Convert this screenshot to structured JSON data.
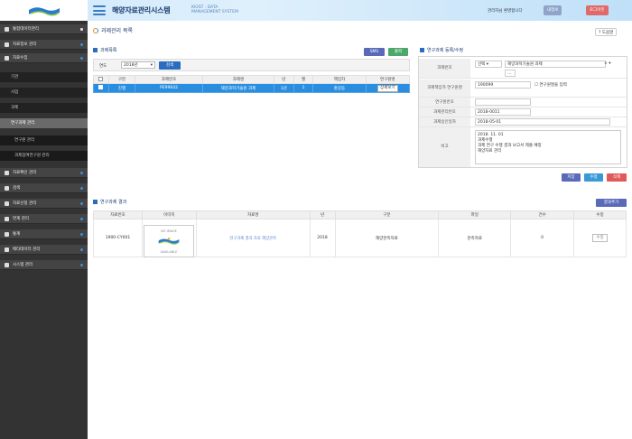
{
  "header": {
    "title": "해양자료관리시스템",
    "subtitle_line1": "KIOST · DATA",
    "subtitle_line2": "MANAGEMENT SYSTEM",
    "user_info": "관리자님 환영합니다",
    "btn_mypage": "내정보",
    "btn_logout": "로그아웃"
  },
  "sidebar": {
    "items": [
      {
        "label": "통합데이터관리"
      },
      {
        "label": "자료정보 관리"
      },
      {
        "label": "자료수집"
      }
    ],
    "subitems": [
      {
        "label": "기관"
      },
      {
        "label": "사업"
      },
      {
        "label": "과제"
      },
      {
        "label": "연구과제 관리"
      },
      {
        "label": "연구원 관리"
      },
      {
        "label": "과제참여연구원 관리"
      }
    ],
    "bottom_items": [
      {
        "label": "자료확인 관리"
      },
      {
        "label": "검색"
      },
      {
        "label": "자료신청 관리"
      },
      {
        "label": "연계 관리"
      },
      {
        "label": "통계"
      },
      {
        "label": "메타데이터 관리"
      },
      {
        "label": "시스템 관리"
      }
    ]
  },
  "page": {
    "title": "과제관리 목록",
    "help_label": "도움말"
  },
  "list_section": {
    "title": "과제목록",
    "btn_sms": "SMS",
    "btn_excel": "출력",
    "filter_label": "연도",
    "filter_value": "2018년",
    "btn_search": "검색",
    "columns": [
      "",
      "구분",
      "과제번호",
      "과제명",
      "년",
      "월",
      "책임자",
      "연구원명"
    ],
    "rows": [
      {
        "c1": "진행",
        "c2": "PE99642",
        "c3": "해양과학기술원 과제",
        "c4": "1년",
        "c5": "1",
        "c6": "홍길동",
        "c7": "홍길동"
      }
    ],
    "row_button": "상세보기"
  },
  "form_section": {
    "title": "연구과제 등록/수정",
    "fields": [
      {
        "label": "과제번호",
        "value": "선택",
        "value2": "해양과학기술원 과제"
      },
      {
        "label": "과제책임자 연구원명",
        "value": "190099",
        "value2": "연구원명을 입력"
      },
      {
        "label": "연구원번호",
        "value": ""
      },
      {
        "label": "과제관리번호",
        "value": "2018-0011"
      },
      {
        "label": "과제승인일자",
        "value": "2018-05-01"
      }
    ],
    "memo_label": "비고",
    "memo_lines": [
      "2018. 11. 01",
      "과제수행",
      "과제 연구 수행 결과 보고서 제출 예정",
      "해양자료 관리"
    ],
    "btn_save": "저장",
    "btn_edit": "수정",
    "btn_delete": "삭제"
  },
  "result_section": {
    "title": "연구과제 결과",
    "btn_add": "결과추가",
    "columns": [
      "자료번호",
      "이미지",
      "자료명",
      "년",
      "구분",
      "파일",
      "건수",
      "수정"
    ],
    "rows": [
      {
        "c0": "1900-CY001",
        "c2": "연구과제 결과 자료 해양관측",
        "c3": "2018",
        "c4": "해양관측자료",
        "c5": "관측자료",
        "c6": "0",
        "c7": "수정"
      }
    ],
    "image_caption_top": "NO IMAGE",
    "image_caption_bottom": "AVAILABLE"
  },
  "colors": {
    "accent": "#2a6cc0",
    "sidebar_bg": "#333333",
    "selected_row": "#2a8ee0",
    "btn_green": "#4aa86a",
    "btn_purple": "#5a6ab8",
    "btn_blue": "#3a9ad8",
    "btn_red": "#e05a5a"
  }
}
